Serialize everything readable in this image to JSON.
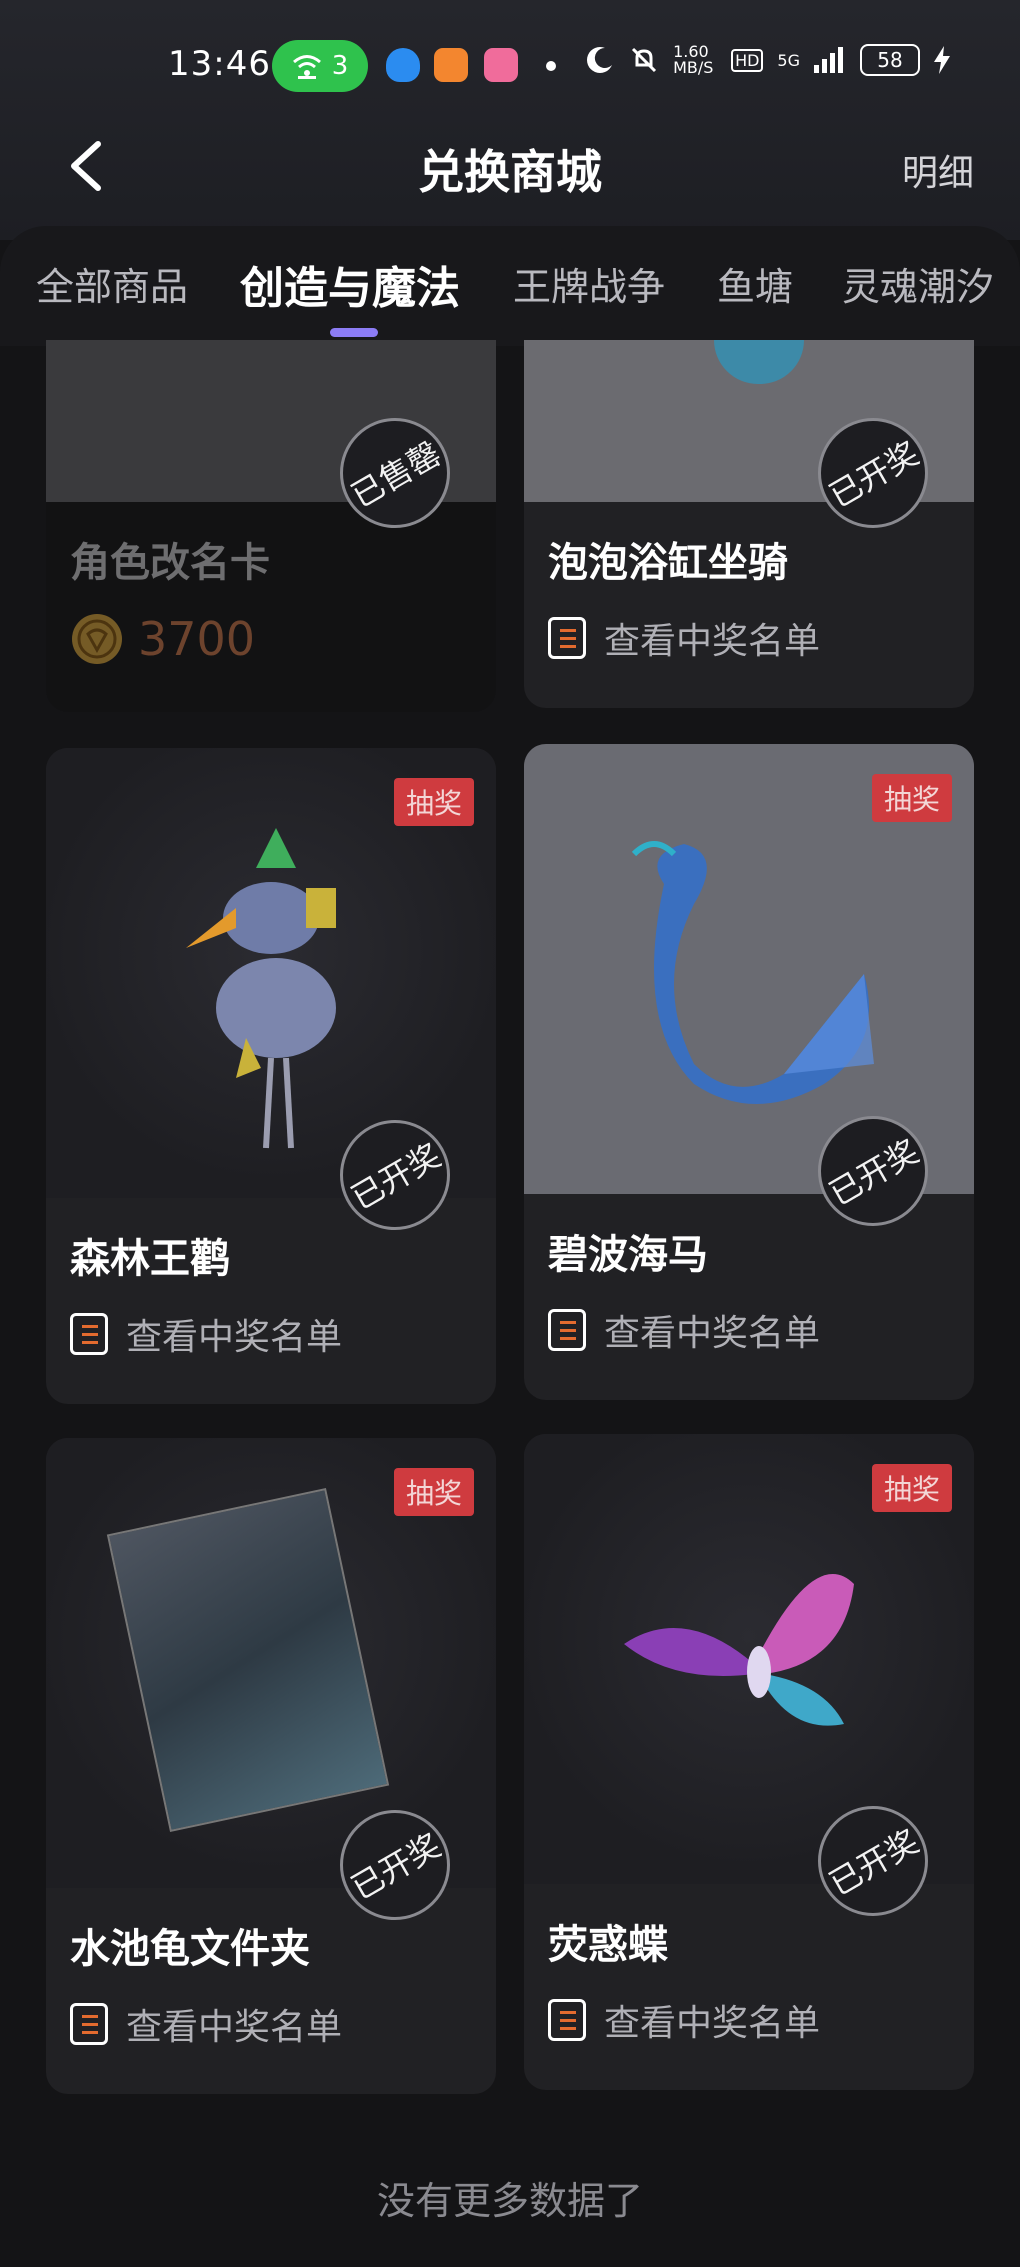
{
  "status_bar": {
    "time": "13:46",
    "wifi_count": "3",
    "net_speed": "1.60 MB/S",
    "hd": "HD",
    "signal": "5G",
    "battery": "58"
  },
  "header": {
    "title": "兑换商城",
    "detail_label": "明细"
  },
  "tabs": [
    {
      "label": "全部商品"
    },
    {
      "label": "创造与魔法"
    },
    {
      "label": "王牌战争"
    },
    {
      "label": "鱼塘"
    },
    {
      "label": "灵魂潮汐"
    }
  ],
  "cards": [
    {
      "name": "角色改名卡",
      "stamp": "已售罄",
      "price": "3700"
    },
    {
      "name": "泡泡浴缸坐骑",
      "stamp": "已开奖",
      "link": "查看中奖名单"
    },
    {
      "name": "森林王鹳",
      "badge": "抽奖",
      "stamp": "已开奖",
      "link": "查看中奖名单"
    },
    {
      "name": "碧波海马",
      "badge": "抽奖",
      "stamp": "已开奖",
      "link": "查看中奖名单"
    },
    {
      "name": "水池龟文件夹",
      "badge": "抽奖",
      "stamp": "已开奖",
      "link": "查看中奖名单"
    },
    {
      "name": "荧惑蝶",
      "badge": "抽奖",
      "stamp": "已开奖",
      "link": "查看中奖名单"
    }
  ],
  "footer_text": "没有更多数据了",
  "colors": {
    "accent": "#8c7cf5",
    "lottery_badge": "#cf3b3f",
    "price": "#c77a52",
    "wifi_pill": "#2fc24d"
  }
}
